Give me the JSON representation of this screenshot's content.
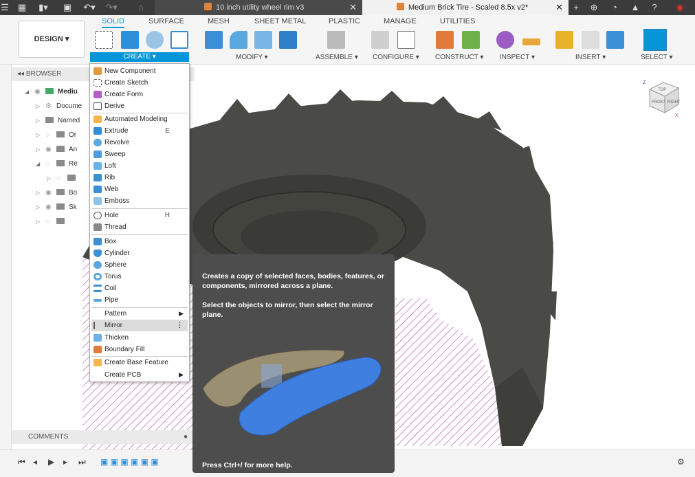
{
  "titlebar": {
    "tab1": "10 inch utility wheel rim v3",
    "tab2": "Medium Brick Tire - Scaled 8.5x v2*"
  },
  "ribbon": {
    "tabs": [
      "SOLID",
      "SURFACE",
      "MESH",
      "SHEET METAL",
      "PLASTIC",
      "MANAGE",
      "UTILITIES"
    ],
    "design": "DESIGN ▾",
    "groups": {
      "create": "CREATE ▾",
      "modify": "MODIFY ▾",
      "assemble": "ASSEMBLE ▾",
      "configure": "CONFIGURE ▾",
      "construct": "CONSTRUCT ▾",
      "inspect": "INSPECT ▾",
      "insert": "INSERT ▾",
      "select": "SELECT ▾"
    }
  },
  "browser": {
    "title": "BROWSER",
    "rows": [
      "Mediu",
      "Docume",
      "Named",
      "Or",
      "An",
      "Re",
      "",
      "Bo",
      "Sk",
      ""
    ],
    "comments": "COMMENTS"
  },
  "menu": {
    "items": [
      {
        "label": "New Component"
      },
      {
        "label": "Create Sketch"
      },
      {
        "label": "Create Form"
      },
      {
        "label": "Derive"
      },
      {
        "label": "Automated Modeling"
      },
      {
        "label": "Extrude",
        "shortcut": "E"
      },
      {
        "label": "Revolve"
      },
      {
        "label": "Sweep"
      },
      {
        "label": "Loft"
      },
      {
        "label": "Rib"
      },
      {
        "label": "Web"
      },
      {
        "label": "Emboss"
      },
      {
        "label": "Hole",
        "shortcut": "H"
      },
      {
        "label": "Thread"
      },
      {
        "label": "Box"
      },
      {
        "label": "Cylinder"
      },
      {
        "label": "Sphere"
      },
      {
        "label": "Torus"
      },
      {
        "label": "Coil"
      },
      {
        "label": "Pipe"
      },
      {
        "label": "Pattern"
      },
      {
        "label": "Mirror"
      },
      {
        "label": "Thicken"
      },
      {
        "label": "Boundary Fill"
      },
      {
        "label": "Create Base Feature"
      },
      {
        "label": "Create PCB"
      }
    ]
  },
  "tooltip": {
    "line1": "Creates a copy of selected faces, bodies, features, or components, mirrored across a plane.",
    "line2": "Select the objects to mirror, then select the mirror plane.",
    "footer": "Press Ctrl+/ for more help."
  },
  "viewcube": {
    "top": "TOP",
    "front": "FRONT",
    "right": "RIGHT",
    "x": "X",
    "z": "Z"
  }
}
